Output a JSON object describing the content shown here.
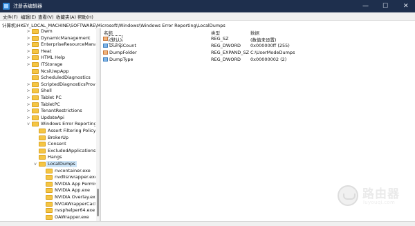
{
  "window": {
    "title": "注册表编辑器",
    "minimize": "—",
    "maximize": "☐",
    "close": "✕"
  },
  "menu": [
    "文件(F)",
    "编辑(E)",
    "查看(V)",
    "收藏夹(A)",
    "帮助(H)"
  ],
  "address": "计算机\\HKEY_LOCAL_MACHINE\\SOFTWARE\\Microsoft\\Windows\\Windows Error Reporting\\LocalDumps",
  "tree": [
    {
      "label": "Dwm",
      "depth": 0,
      "expander": ">"
    },
    {
      "label": "DynamicManagement",
      "depth": 0,
      "expander": ">"
    },
    {
      "label": "EnterpriseResourceManage",
      "depth": 0,
      "expander": ">"
    },
    {
      "label": "Heat",
      "depth": 0,
      "expander": ">"
    },
    {
      "label": "HTML Help",
      "depth": 0,
      "expander": ">"
    },
    {
      "label": "ITStorage",
      "depth": 0,
      "expander": ">"
    },
    {
      "label": "NcsiUwpApp",
      "depth": 0,
      "expander": ""
    },
    {
      "label": "ScheduledDiagnostics",
      "depth": 0,
      "expander": ""
    },
    {
      "label": "ScriptedDiagnosticsProvide",
      "depth": 0,
      "expander": ">"
    },
    {
      "label": "Shell",
      "depth": 0,
      "expander": ">"
    },
    {
      "label": "Tablet PC",
      "depth": 0,
      "expander": ">"
    },
    {
      "label": "TabletPC",
      "depth": 0,
      "expander": ">"
    },
    {
      "label": "TenantRestrictions",
      "depth": 0,
      "expander": ">"
    },
    {
      "label": "UpdateApi",
      "depth": 0,
      "expander": ">"
    },
    {
      "label": "Windows Error Reporting",
      "depth": 0,
      "expander": "v"
    },
    {
      "label": "Assert Filtering Policy",
      "depth": 1,
      "expander": ""
    },
    {
      "label": "BrokerUp",
      "depth": 1,
      "expander": ""
    },
    {
      "label": "Consent",
      "depth": 1,
      "expander": ""
    },
    {
      "label": "ExcludedApplications",
      "depth": 1,
      "expander": ""
    },
    {
      "label": "Hangs",
      "depth": 1,
      "expander": ""
    },
    {
      "label": "LocalDumps",
      "depth": 1,
      "expander": "v",
      "selected": true
    },
    {
      "label": "nvcontainer.exe",
      "depth": 2,
      "expander": ""
    },
    {
      "label": "nvdlisrwrapper.exe",
      "depth": 2,
      "expander": ""
    },
    {
      "label": "NVIDIA App Permissic",
      "depth": 2,
      "expander": ""
    },
    {
      "label": "NVIDIA App.exe",
      "depth": 2,
      "expander": ""
    },
    {
      "label": "NVIDIA Overlay.exe",
      "depth": 2,
      "expander": ""
    },
    {
      "label": "NVOAWrapperCache.e",
      "depth": 2,
      "expander": ""
    },
    {
      "label": "nvsphelper64.exe",
      "depth": 2,
      "expander": ""
    },
    {
      "label": "OAWrapper.exe",
      "depth": 2,
      "expander": ""
    }
  ],
  "columns": {
    "name": "名称",
    "type": "类型",
    "data": "数据"
  },
  "values": [
    {
      "name": "(默认)",
      "type": "REG_SZ",
      "data": "(数值未设置)",
      "icon": "ab",
      "selected": true
    },
    {
      "name": "DumpCount",
      "type": "REG_DWORD",
      "data": "0x000000ff (255)",
      "icon": "bin"
    },
    {
      "name": "DumpFolder",
      "type": "REG_EXPAND_SZ",
      "data": "C:\\UserModeDumps",
      "icon": "ab"
    },
    {
      "name": "DumpType",
      "type": "REG_DWORD",
      "data": "0x00000002 (2)",
      "icon": "bin"
    }
  ],
  "watermark": {
    "text": "路由器",
    "sub": "luyouqi.com"
  }
}
